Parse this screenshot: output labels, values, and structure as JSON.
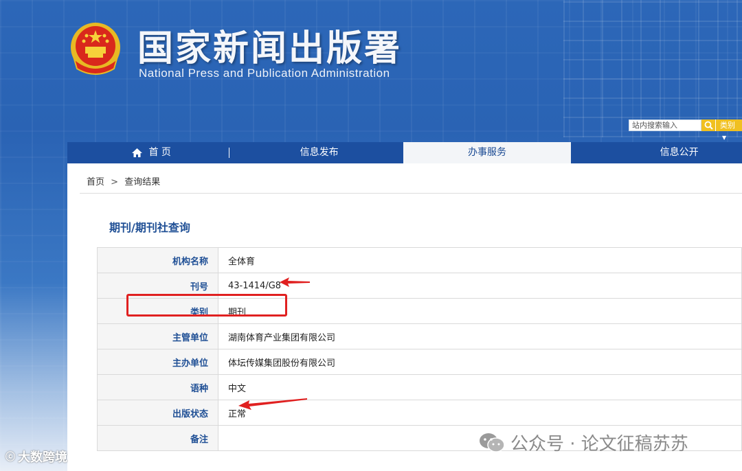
{
  "header": {
    "title_cn": "国家新闻出版署",
    "title_en": "National  Press and Publication Administration",
    "emblem": "national-emblem-icon"
  },
  "search": {
    "placeholder": "站内搜索输入",
    "category_label": "类别"
  },
  "nav": {
    "items": [
      {
        "label": "首 页"
      },
      {
        "label": "信息发布"
      },
      {
        "label": "办事服务"
      },
      {
        "label": "信息公开"
      }
    ],
    "active_index": 2
  },
  "breadcrumb": {
    "home": "首页",
    "separator": ">",
    "current": "查询结果"
  },
  "section_title": "期刊/期刊社查询",
  "rows": [
    {
      "label": "机构名称",
      "value": "全体育"
    },
    {
      "label": "刊号",
      "value": "43-1414/G8"
    },
    {
      "label": "类别",
      "value": "期刊"
    },
    {
      "label": "主管单位",
      "value": "湖南体育产业集团有限公司"
    },
    {
      "label": "主办单位",
      "value": "体坛传媒集团股份有限公司"
    },
    {
      "label": "语种",
      "value": "中文"
    },
    {
      "label": "出版状态",
      "value": "正常"
    },
    {
      "label": "备注",
      "value": ""
    }
  ],
  "watermarks": {
    "wechat": "公众号 · 论文征稿苏苏",
    "left": "大数跨境"
  },
  "colors": {
    "brand_blue": "#1f4f95",
    "nav_blue": "#1c4fa0",
    "annotation_red": "#e02020",
    "search_yellow": "#f0c020"
  }
}
